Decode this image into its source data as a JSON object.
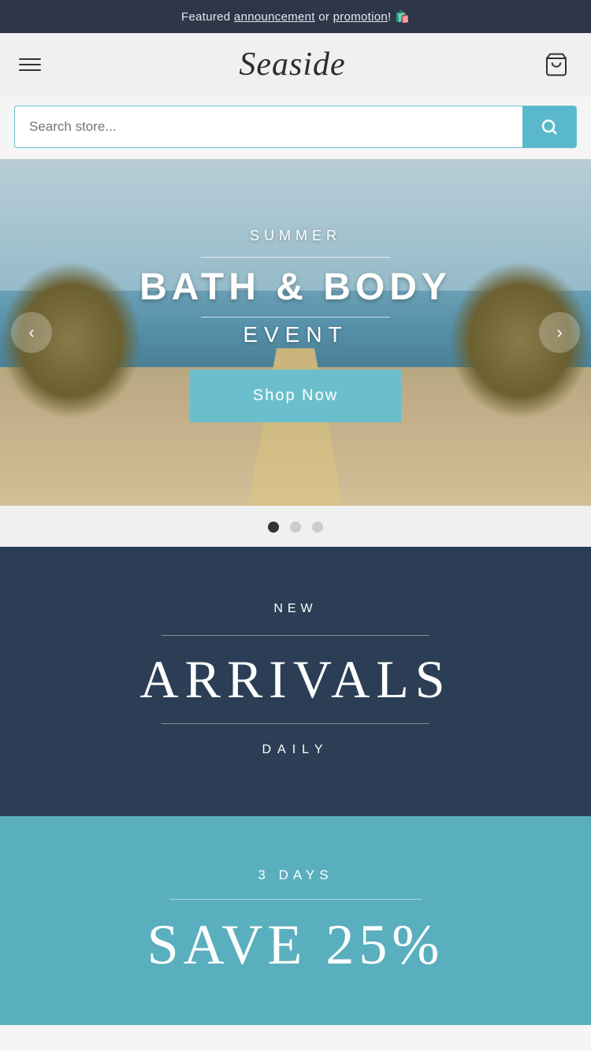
{
  "announcement": {
    "text_before": "Featured ",
    "link1": "announcement",
    "text_middle": " or ",
    "link2": "promotion",
    "emoji": "🛍️"
  },
  "header": {
    "logo": "Seaside",
    "cart_icon_label": "cart"
  },
  "search": {
    "placeholder": "Search store..."
  },
  "hero": {
    "subtitle": "SUMMER",
    "title": "BATH & BODY",
    "title2": "EVENT",
    "cta": "Shop Now",
    "prev_label": "‹",
    "next_label": "›",
    "dots": [
      {
        "active": true
      },
      {
        "active": false
      },
      {
        "active": false
      }
    ]
  },
  "new_arrivals": {
    "label_top": "NEW",
    "title": "ARRIVALS",
    "label_bottom": "DAILY"
  },
  "save_section": {
    "label_top": "3 DAYS",
    "title": "SAVE 25%"
  }
}
